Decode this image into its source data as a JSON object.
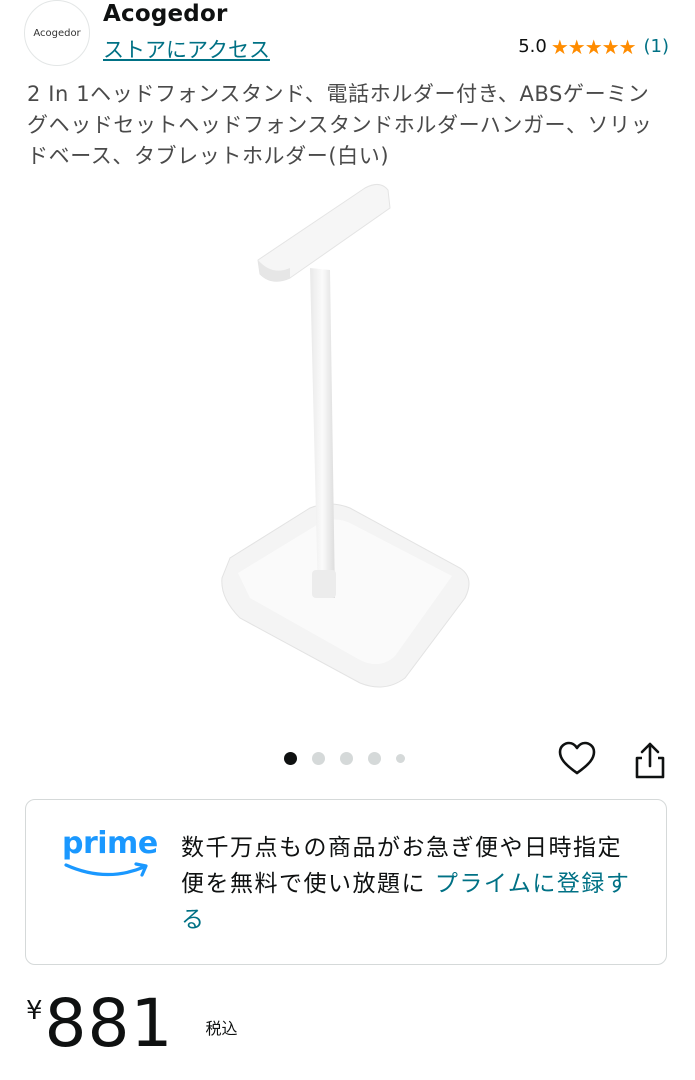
{
  "store": {
    "logo_text": "Acogedor",
    "name": "Acogedor",
    "link_label": "ストアにアクセス",
    "rating": {
      "score": "5.0",
      "stars": "★★★★★",
      "count": "(1)",
      "value": 5.0
    }
  },
  "product": {
    "title": "2 In 1ヘッドフォンスタンド、電話ホルダー付き、ABSゲーミングヘッドセットヘッドフォンスタンドホルダーハンガー、ソリッドベース、タブレットホルダー(白い)",
    "image_icon": "headphone-stand-image",
    "image_count": 5,
    "active_image_index": 0
  },
  "actions": {
    "wishlist_icon": "heart-icon",
    "share_icon": "share-icon"
  },
  "prime": {
    "logo_text": "prime",
    "message": "数千万点もの商品がお急ぎ便や日時指定便を無料で使い放題に ",
    "link": "プライムに登録する"
  },
  "price": {
    "currency": "¥",
    "amount": "881",
    "tax_label": "税込"
  },
  "colors": {
    "link": "#007185",
    "star": "#ff8c00",
    "prime_blue": "#1a98ff",
    "text": "#0f1111"
  }
}
